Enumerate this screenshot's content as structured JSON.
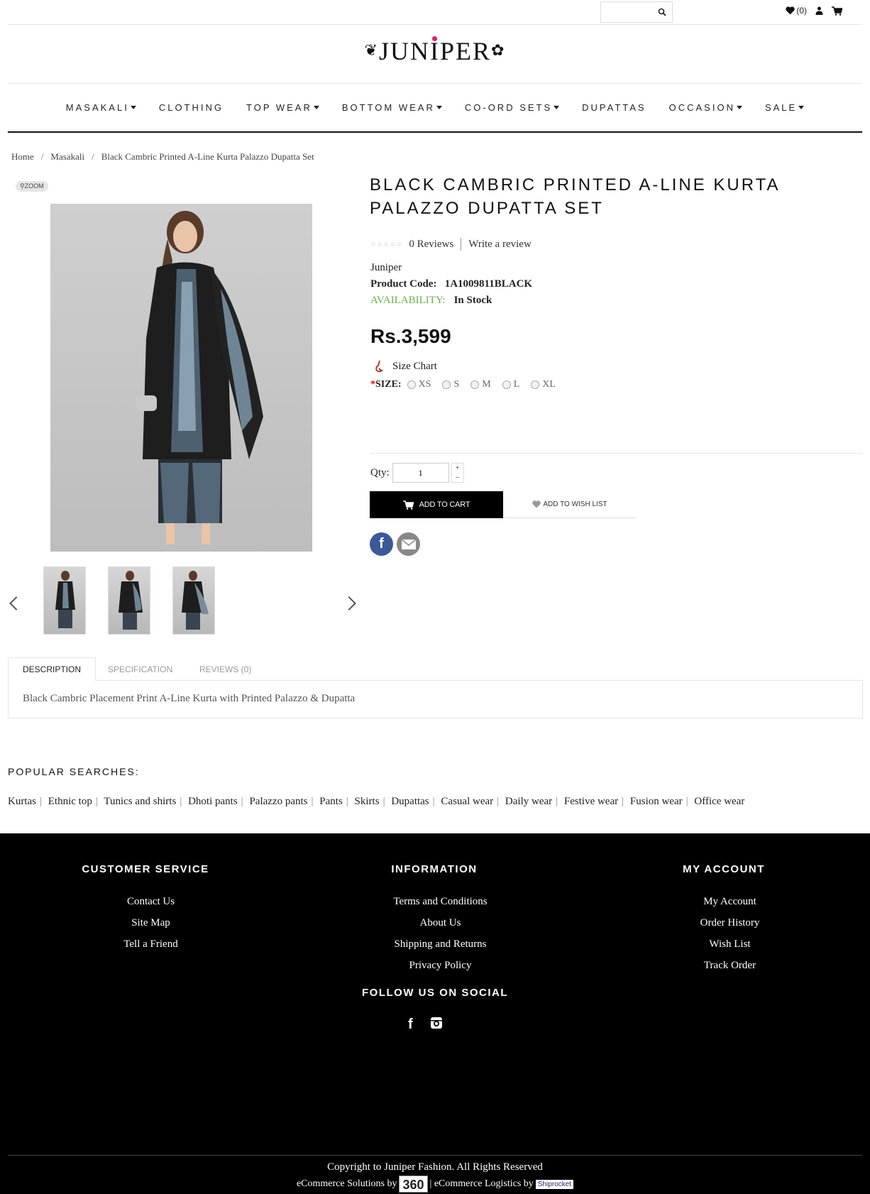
{
  "header": {
    "search_placeholder": "",
    "wishlist_count": "(0)",
    "logo_text": "JUNIPER"
  },
  "nav": {
    "items": [
      {
        "label": "MASAKALI",
        "dropdown": true
      },
      {
        "label": "CLOTHING",
        "dropdown": false
      },
      {
        "label": "TOP WEAR",
        "dropdown": true
      },
      {
        "label": "BOTTOM WEAR",
        "dropdown": true
      },
      {
        "label": "CO-ORD SETS",
        "dropdown": true
      },
      {
        "label": "DUPATTAS",
        "dropdown": false
      },
      {
        "label": "OCCASION",
        "dropdown": true
      },
      {
        "label": "SALE",
        "dropdown": true
      }
    ]
  },
  "breadcrumb": [
    "Home",
    "Masakali",
    "Black Cambric Printed A-Line Kurta Palazzo Dupatta Set"
  ],
  "gallery": {
    "zoom_label": "ZOOM"
  },
  "product": {
    "title": "BLACK CAMBRIC PRINTED A-LINE KURTA PALAZZO DUPATTA SET",
    "reviews_link": "0 Reviews",
    "write_review": "Write a review",
    "brand": "Juniper",
    "code_label": "Product Code:",
    "code_value": "1A1009811BLACK",
    "availability_label": "AVAILABILITY:",
    "availability_value": "In Stock",
    "price": "Rs.3,599",
    "size_chart": "Size Chart",
    "size_label": "SIZE:",
    "sizes": [
      "XS",
      "S",
      "M",
      "L",
      "XL"
    ],
    "qty_label": "Qty:",
    "qty_value": "1",
    "add_to_cart": "ADD TO CART",
    "add_to_wishlist": "ADD TO WISH LIST"
  },
  "tabs": {
    "items": [
      "DESCRIPTION",
      "SPECIFICATION",
      "REVIEWS (0)"
    ],
    "description": "Black Cambric Placement Print A-Line Kurta with Printed Palazzo & Dupatta"
  },
  "popular": {
    "title": "POPULAR SEARCHES:",
    "items": [
      "Kurtas",
      "Ethnic top",
      "Tunics and shirts",
      "Dhoti pants",
      "Palazzo pants",
      "Pants",
      "Skirts",
      "Dupattas",
      "Casual wear",
      "Daily wear",
      "Festive wear",
      "Fusion wear",
      "Office wear"
    ]
  },
  "footer": {
    "customer_service": {
      "title": "CUSTOMER SERVICE",
      "links": [
        "Contact Us",
        "Site Map",
        "Tell a Friend"
      ]
    },
    "information": {
      "title": "INFORMATION",
      "links": [
        "Terms and Conditions",
        "About Us",
        "Shipping and Returns",
        "Privacy Policy"
      ]
    },
    "my_account": {
      "title": "MY ACCOUNT",
      "links": [
        "My Account",
        "Order History",
        "Wish List",
        "Track Order"
      ]
    },
    "follow_title": "FOLLOW US ON SOCIAL",
    "copyright": "Copyright to Juniper Fashion. All Rights Reserved",
    "ecommerce_solutions": "eCommerce Solutions by",
    "ecommerce_logistics": "| eCommerce Logistics by",
    "badge_360": "360",
    "badge_shiprocket": "Shiprocket"
  },
  "colors": {
    "accent_pink": "#e0197d",
    "availability_green": "#6ab04c",
    "facebook_blue": "#3b5998",
    "footer_bg": "#000000"
  }
}
